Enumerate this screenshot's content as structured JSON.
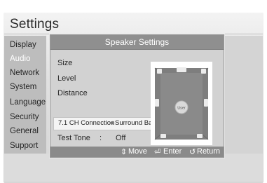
{
  "screen": {
    "title": "Settings"
  },
  "menu": {
    "items": [
      {
        "label": "Display",
        "active": false
      },
      {
        "label": "Audio",
        "active": true
      },
      {
        "label": "Network",
        "active": false
      },
      {
        "label": "System",
        "active": false
      },
      {
        "label": "Language",
        "active": false
      },
      {
        "label": "Security",
        "active": false
      },
      {
        "label": "General",
        "active": false
      },
      {
        "label": "Support",
        "active": false
      }
    ]
  },
  "dialog": {
    "title": "Speaker Settings",
    "options": [
      {
        "label": "Size"
      },
      {
        "label": "Level"
      },
      {
        "label": "Distance"
      }
    ],
    "connection": {
      "label": "7.1 CH Connection",
      "value": "Surround Back"
    },
    "test_tone": {
      "label": "Test Tone",
      "separator": ":",
      "value": "Off"
    },
    "diagram": {
      "listener_label": "User"
    },
    "footer": {
      "move": "Move",
      "enter": "Enter",
      "return": "Return"
    }
  },
  "colors": {
    "active_menu_text": "#ffffff",
    "dialog_header": "#8f8f8f",
    "footer": "#8a8a8a"
  }
}
